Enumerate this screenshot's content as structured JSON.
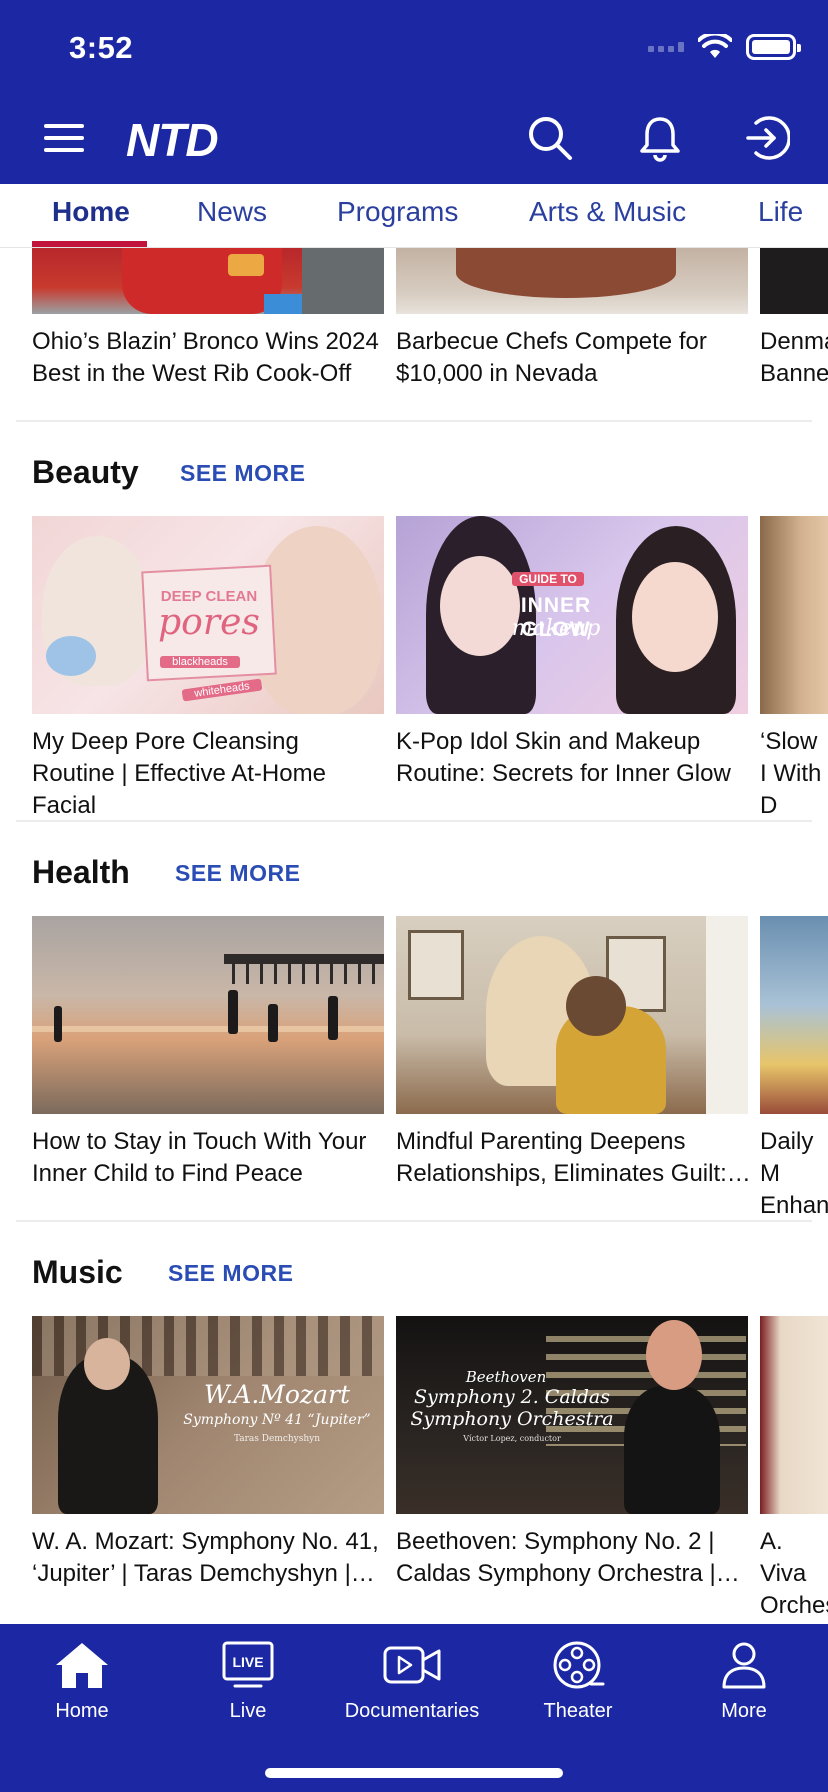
{
  "status": {
    "time": "3:52"
  },
  "header": {
    "logo": "NTD"
  },
  "tabs": [
    {
      "label": "Home",
      "active": true
    },
    {
      "label": "News"
    },
    {
      "label": "Programs"
    },
    {
      "label": "Arts & Music"
    },
    {
      "label": "Life"
    }
  ],
  "top_row": {
    "cards": [
      {
        "title": "Ohio’s Blazin’ Bronco Wins 2024 Best in the West Rib Cook-Off"
      },
      {
        "title": "Barbecue Chefs Compete for $10,000 in Nevada"
      },
      {
        "title": "Denma Banne"
      }
    ]
  },
  "sections": [
    {
      "title": "Beauty",
      "see_more": "SEE MORE",
      "cards": [
        {
          "title": "My Deep Pore Cleansing Routine | Effective At-Home Facial",
          "overlay_1": "DEEP CLEAN",
          "overlay_2": "pores",
          "overlay_3": "blackheads",
          "overlay_4": "whiteheads"
        },
        {
          "title": "K-Pop Idol Skin and Makeup Routine: Secrets for Inner Glow",
          "overlay_1": "GUIDE TO",
          "overlay_2": "INNER GLOW",
          "overlay_3": "makeup"
        },
        {
          "title": "‘Slow I With D"
        }
      ]
    },
    {
      "title": "Health",
      "see_more": "SEE MORE",
      "cards": [
        {
          "title": "How to Stay in Touch With Your Inner Child to Find Peace"
        },
        {
          "title": "Mindful Parenting Deepens Relationships, Eliminates Guilt:…"
        },
        {
          "title": "Daily M Enhanc"
        }
      ]
    },
    {
      "title": "Music",
      "see_more": "SEE MORE",
      "cards": [
        {
          "title": "W. A. Mozart: Symphony No. 41, ‘Jupiter’ | Taras Demchyshyn |…",
          "overlay_1": "W.A.Mozart",
          "overlay_2": "Symphony Nº 41 “Jupiter”",
          "overlay_3": "Taras Demchyshyn"
        },
        {
          "title": "Beethoven: Symphony No. 2 | Caldas Symphony Orchestra |…",
          "overlay_1": "Beethoven",
          "overlay_2": "Symphony 2. Caldas",
          "overlay_3": "Symphony Orchestra",
          "overlay_4": "Víctor Lopez, conductor"
        },
        {
          "title": "A. Viva Orches"
        }
      ]
    }
  ],
  "bottom_nav": [
    {
      "label": "Home",
      "icon": "home-icon"
    },
    {
      "label": "Live",
      "icon": "live-icon",
      "badge": "LIVE"
    },
    {
      "label": "Documentaries",
      "icon": "video-camera-icon"
    },
    {
      "label": "Theater",
      "icon": "film-reel-icon"
    },
    {
      "label": "More",
      "icon": "person-icon"
    }
  ],
  "colors": {
    "brand": "#1c28a3",
    "accent": "#c0143c",
    "link": "#2a4cb5"
  }
}
